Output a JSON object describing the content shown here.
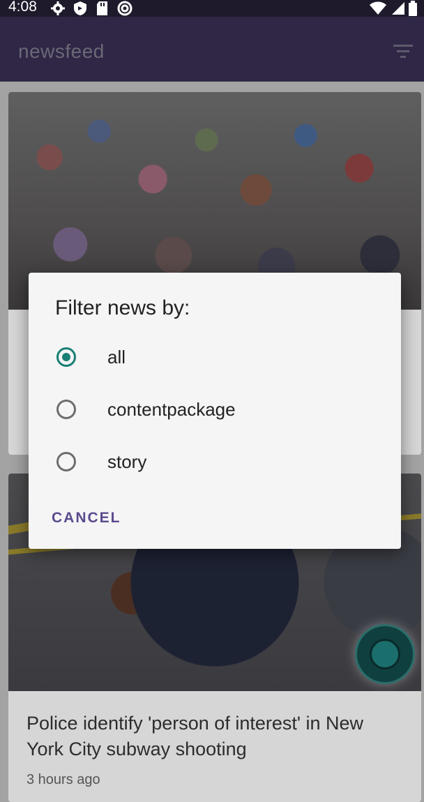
{
  "status_bar": {
    "time": "4:08",
    "left_icons": [
      "gear-icon",
      "shield-icon",
      "sd-card-icon",
      "at-sign-icon"
    ],
    "right_icons": [
      "wifi-icon",
      "signal-icon",
      "battery-icon"
    ]
  },
  "app_bar": {
    "title": "newsfeed",
    "filter_icon": "filter-icon"
  },
  "feed": {
    "cards": [
      {
        "image": "marathon-runners-photo",
        "headline": "",
        "time": ""
      },
      {
        "image": "police-officer-photo",
        "headline": "Police identify 'person of interest' in New York City subway shooting",
        "time": "3 hours ago"
      }
    ]
  },
  "dialog": {
    "title": "Filter news by:",
    "options": [
      {
        "label": "all",
        "selected": true
      },
      {
        "label": "contentpackage",
        "selected": false
      },
      {
        "label": "story",
        "selected": false
      }
    ],
    "cancel_label": "CANCEL"
  },
  "colors": {
    "accent": "#1a7f74",
    "button_text": "#5b4a8d",
    "app_bar": "#2f2745"
  }
}
